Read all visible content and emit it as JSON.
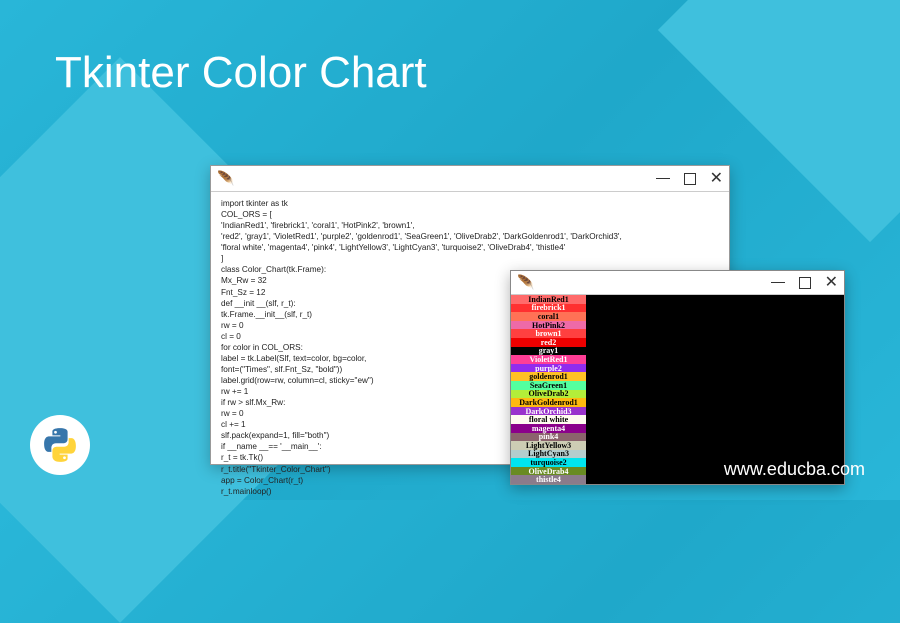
{
  "page_title": "Tkinter Color Chart",
  "site_url": "www.educba.com",
  "code_window": {
    "code": "import tkinter as tk\nCOL_ORS = [\n'IndianRed1', 'firebrick1', 'coral1', 'HotPink2', 'brown1',\n'red2', 'gray1', 'VioletRed1', 'purple2', 'goldenrod1', 'SeaGreen1', 'OliveDrab2', 'DarkGoldenrod1', 'DarkOrchid3',\n'floral white', 'magenta4', 'pink4', 'LightYellow3', 'LightCyan3', 'turquoise2', 'OliveDrab4', 'thistle4'\n]\nclass Color_Chart(tk.Frame):\nMx_Rw = 32\nFnt_Sz = 12\ndef __init __(slf, r_t):\ntk.Frame.__init__(slf, r_t)\nrw = 0\ncl = 0\nfor color in COL_ORS:\nlabel = tk.Label(Slf, text=color, bg=color,\nfont=(\"Times\", slf.Fnt_Sz, \"bold\"))\nlabel.grid(row=rw, column=cl, sticky=\"ew\")\nrw += 1\nif rw > slf.Mx_Rw:\nrw = 0\ncl += 1\nslf.pack(expand=1, fill=\"both\")\nif __name __== '__main__':\nr_t = tk.Tk()\nr_t.title(\"Tkinter_Color_Chart\")\napp = Color_Chart(r_t)\nr_t.mainloop()"
  },
  "chart_swatches": [
    {
      "name": "IndianRed1",
      "bg": "#ff6a6a"
    },
    {
      "name": "firebrick1",
      "bg": "#ff3030"
    },
    {
      "name": "coral1",
      "bg": "#ff7256"
    },
    {
      "name": "HotPink2",
      "bg": "#ee6aa7"
    },
    {
      "name": "brown1",
      "bg": "#ff4040"
    },
    {
      "name": "red2",
      "bg": "#ee0000"
    },
    {
      "name": "gray1",
      "bg": "#030303"
    },
    {
      "name": "VioletRed1",
      "bg": "#ff3e96"
    },
    {
      "name": "purple2",
      "bg": "#912cee"
    },
    {
      "name": "goldenrod1",
      "bg": "#ffc125"
    },
    {
      "name": "SeaGreen1",
      "bg": "#54ff9f"
    },
    {
      "name": "OliveDrab2",
      "bg": "#b3ee3a"
    },
    {
      "name": "DarkGoldenrod1",
      "bg": "#ffb90f"
    },
    {
      "name": "DarkOrchid3",
      "bg": "#9a32cd"
    },
    {
      "name": "floral white",
      "bg": "#fffaf0"
    },
    {
      "name": "magenta4",
      "bg": "#8b008b"
    },
    {
      "name": "pink4",
      "bg": "#8b636c"
    },
    {
      "name": "LightYellow3",
      "bg": "#cdcdb4"
    },
    {
      "name": "LightCyan3",
      "bg": "#b4cdcd"
    },
    {
      "name": "turquoise2",
      "bg": "#00e5ee"
    },
    {
      "name": "OliveDrab4",
      "bg": "#698b22"
    },
    {
      "name": "thistle4",
      "bg": "#8b7b8b"
    }
  ]
}
